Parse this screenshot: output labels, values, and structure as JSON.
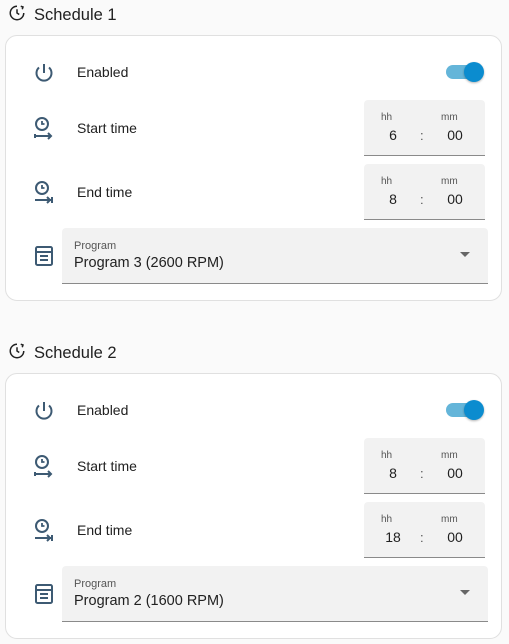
{
  "colors": {
    "accent": "#0b8ccf",
    "track": "#64b5d9",
    "icon": "#3d5a73"
  },
  "schedules": [
    {
      "title": "Schedule 1",
      "enabled_label": "Enabled",
      "enabled": true,
      "start_label": "Start time",
      "start": {
        "hh_label": "hh",
        "mm_label": "mm",
        "hh": "6",
        "mm": "00"
      },
      "end_label": "End time",
      "end": {
        "hh_label": "hh",
        "mm_label": "mm",
        "hh": "8",
        "mm": "00"
      },
      "program_label": "Program",
      "program_value": "Program 3 (2600 RPM)"
    },
    {
      "title": "Schedule 2",
      "enabled_label": "Enabled",
      "enabled": true,
      "start_label": "Start time",
      "start": {
        "hh_label": "hh",
        "mm_label": "mm",
        "hh": "8",
        "mm": "00"
      },
      "end_label": "End time",
      "end": {
        "hh_label": "hh",
        "mm_label": "mm",
        "hh": "18",
        "mm": "00"
      },
      "program_label": "Program",
      "program_value": "Program 2 (1600 RPM)"
    }
  ],
  "separator": ":"
}
